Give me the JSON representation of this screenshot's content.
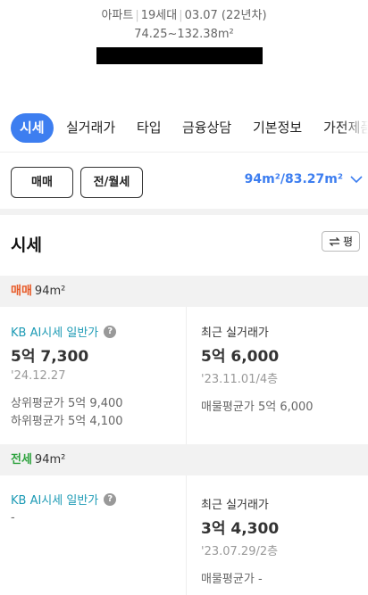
{
  "summary": {
    "type": "아파트",
    "households": "19세대",
    "built": "03.07 (22년차)",
    "area_range": "74.25~132.38m²"
  },
  "tabs": [
    {
      "label": "시세",
      "active": true
    },
    {
      "label": "실거래가",
      "active": false
    },
    {
      "label": "타입",
      "active": false
    },
    {
      "label": "금융상담",
      "active": false
    },
    {
      "label": "기본정보",
      "active": false
    },
    {
      "label": "가전제품",
      "active": false
    }
  ],
  "filters": {
    "trade_type_label": "매매",
    "rent_type_label": "전/월세",
    "area_selected": "94m²/83.27m²"
  },
  "price_section": {
    "title": "시세",
    "toggle_label": "평",
    "sale": {
      "kind": "매매",
      "area": "94m²",
      "kb_label": "KB AI시세 일반가",
      "kb_price": "5억 7,300",
      "kb_date": "'24.12.27",
      "upper_avg_label": "상위평균가",
      "upper_avg_value": "5억 9,400",
      "lower_avg_label": "하위평균가",
      "lower_avg_value": "5억 4,100",
      "recent_label": "최근 실거래가",
      "recent_price": "5억 6,000",
      "recent_date": "'23.11.01/4층",
      "listing_avg_label": "매물평균가",
      "listing_avg_value": "5억 6,000"
    },
    "jeonse": {
      "kind": "전세",
      "area": "94m²",
      "kb_label": "KB AI시세 일반가",
      "kb_value": "-",
      "recent_label": "최근 실거래가",
      "recent_price": "3억 4,300",
      "recent_date": "'23.07.29/2층",
      "listing_avg_label": "매물평균가",
      "listing_avg_value": "-"
    }
  },
  "colors": {
    "accent": "#3d7ef0",
    "sale": "#e85a27",
    "jeonse": "#2fa33f",
    "kb": "#1e9bb5"
  }
}
